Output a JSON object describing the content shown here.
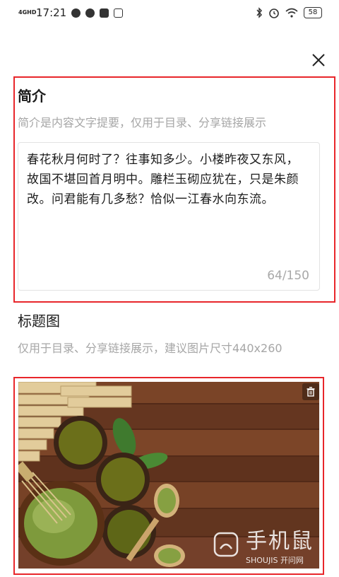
{
  "status_bar": {
    "network": "4GHD",
    "time": "17:21",
    "battery": "58"
  },
  "intro": {
    "title": "简介",
    "description": "简介是内容文字提要，仅用于目录、分享链接展示",
    "text": "春花秋月何时了？往事知多少。小楼昨夜又东风，故国不堪回首月明中。雕栏玉砌应犹在，只是朱颜改。问君能有几多愁？恰似一江春水向东流。",
    "counter": "64/150"
  },
  "cover": {
    "title": "标题图",
    "description": "仅用于目录、分享链接展示，建议图片尺寸440x260"
  },
  "watermark": {
    "brand": "手机鼠",
    "sub": "SHOUJIS",
    "tag": "开问网"
  },
  "icons": {
    "close": "close-icon",
    "delete": "trash-icon"
  },
  "colors": {
    "highlight_border": "#e8262b",
    "hint_text": "#a6a6a6"
  }
}
